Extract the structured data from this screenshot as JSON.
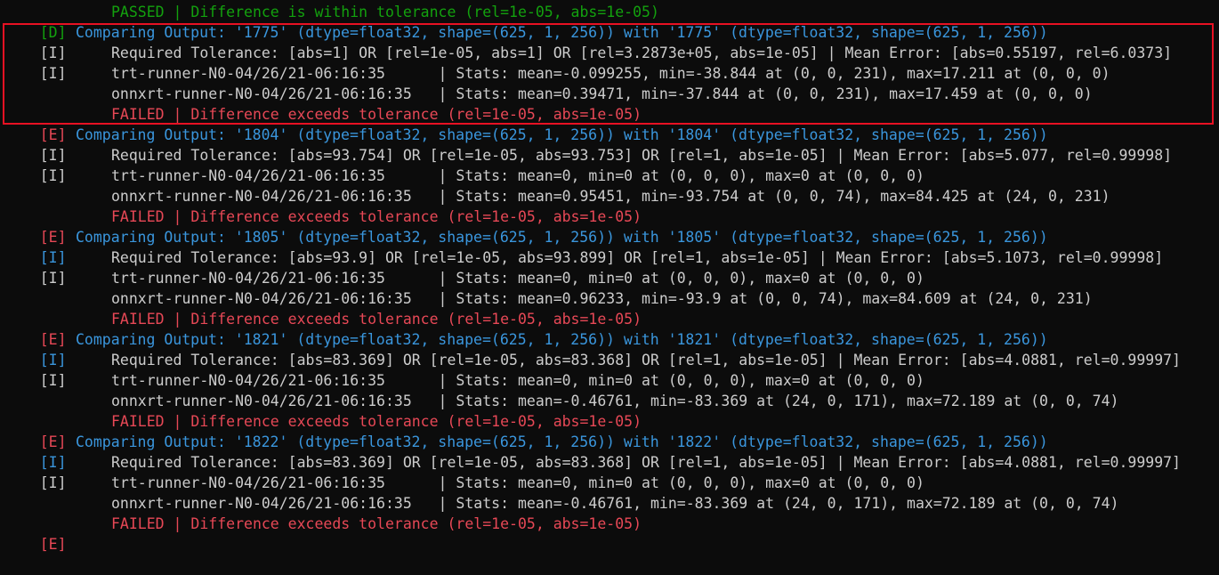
{
  "colors": {
    "background": "#0c0c0c",
    "debug": "#13a10e",
    "info": "#3a96dd",
    "error": "#e74856",
    "text": "#cccccc",
    "highlight_border": "#e81123"
  },
  "lines": [
    {
      "tag": "[D]",
      "text": "PASSED | Difference is within tolerance (rel=1e-05, abs=1e-05)"
    },
    {
      "tag": "[I]",
      "text": "Comparing Output: '1775' (dtype=float32, shape=(625, 1, 256)) with '1775' (dtype=float32, shape=(625, 1, 256))"
    },
    {
      "tag": "[I]",
      "text": "Required Tolerance: [abs=1] OR [rel=1e-05, abs=1] OR [rel=3.2873e+05, abs=1e-05] | Mean Error: [abs=0.55197, rel=6.0373]"
    },
    {
      "tag": "",
      "text": "trt-runner-N0-04/26/21-06:16:35      | Stats: mean=-0.099255, min=-38.844 at (0, 0, 231), max=17.211 at (0, 0, 0)"
    },
    {
      "tag": "",
      "text": "onnxrt-runner-N0-04/26/21-06:16:35   | Stats: mean=0.39471, min=-37.844 at (0, 0, 231), max=17.459 at (0, 0, 0)"
    },
    {
      "tag": "[E]",
      "text": "FAILED | Difference exceeds tolerance (rel=1e-05, abs=1e-05)"
    },
    {
      "tag": "[I]",
      "text": "Comparing Output: '1804' (dtype=float32, shape=(625, 1, 256)) with '1804' (dtype=float32, shape=(625, 1, 256))"
    },
    {
      "tag": "[I]",
      "text": "Required Tolerance: [abs=93.754] OR [rel=1e-05, abs=93.753] OR [rel=1, abs=1e-05] | Mean Error: [abs=5.077, rel=0.99998]"
    },
    {
      "tag": "",
      "text": "trt-runner-N0-04/26/21-06:16:35      | Stats: mean=0, min=0 at (0, 0, 0), max=0 at (0, 0, 0)"
    },
    {
      "tag": "",
      "text": "onnxrt-runner-N0-04/26/21-06:16:35   | Stats: mean=0.95451, min=-93.754 at (0, 0, 74), max=84.425 at (24, 0, 231)"
    },
    {
      "tag": "[E]",
      "text": "FAILED | Difference exceeds tolerance (rel=1e-05, abs=1e-05)"
    },
    {
      "tag": "[I]",
      "text": "Comparing Output: '1805' (dtype=float32, shape=(625, 1, 256)) with '1805' (dtype=float32, shape=(625, 1, 256))"
    },
    {
      "tag": "[I]",
      "text": "Required Tolerance: [abs=93.9] OR [rel=1e-05, abs=93.899] OR [rel=1, abs=1e-05] | Mean Error: [abs=5.1073, rel=0.99998]"
    },
    {
      "tag": "",
      "text": "trt-runner-N0-04/26/21-06:16:35      | Stats: mean=0, min=0 at (0, 0, 0), max=0 at (0, 0, 0)"
    },
    {
      "tag": "",
      "text": "onnxrt-runner-N0-04/26/21-06:16:35   | Stats: mean=0.96233, min=-93.9 at (0, 0, 74), max=84.609 at (24, 0, 231)"
    },
    {
      "tag": "[E]",
      "text": "FAILED | Difference exceeds tolerance (rel=1e-05, abs=1e-05)"
    },
    {
      "tag": "[I]",
      "text": "Comparing Output: '1821' (dtype=float32, shape=(625, 1, 256)) with '1821' (dtype=float32, shape=(625, 1, 256))"
    },
    {
      "tag": "[I]",
      "text": "Required Tolerance: [abs=83.369] OR [rel=1e-05, abs=83.368] OR [rel=1, abs=1e-05] | Mean Error: [abs=4.0881, rel=0.99997]"
    },
    {
      "tag": "",
      "text": "trt-runner-N0-04/26/21-06:16:35      | Stats: mean=0, min=0 at (0, 0, 0), max=0 at (0, 0, 0)"
    },
    {
      "tag": "",
      "text": "onnxrt-runner-N0-04/26/21-06:16:35   | Stats: mean=-0.46761, min=-83.369 at (24, 0, 171), max=72.189 at (0, 0, 74)"
    },
    {
      "tag": "[E]",
      "text": "FAILED | Difference exceeds tolerance (rel=1e-05, abs=1e-05)"
    },
    {
      "tag": "[I]",
      "text": "Comparing Output: '1822' (dtype=float32, shape=(625, 1, 256)) with '1822' (dtype=float32, shape=(625, 1, 256))"
    },
    {
      "tag": "[I]",
      "text": "Required Tolerance: [abs=83.369] OR [rel=1e-05, abs=83.368] OR [rel=1, abs=1e-05] | Mean Error: [abs=4.0881, rel=0.99997]"
    },
    {
      "tag": "",
      "text": "trt-runner-N0-04/26/21-06:16:35      | Stats: mean=0, min=0 at (0, 0, 0), max=0 at (0, 0, 0)"
    },
    {
      "tag": "",
      "text": "onnxrt-runner-N0-04/26/21-06:16:35   | Stats: mean=-0.46761, min=-83.369 at (24, 0, 171), max=72.189 at (0, 0, 74)"
    },
    {
      "tag": "[E]",
      "text": "FAILED | Difference exceeds tolerance (rel=1e-05, abs=1e-05)"
    }
  ]
}
